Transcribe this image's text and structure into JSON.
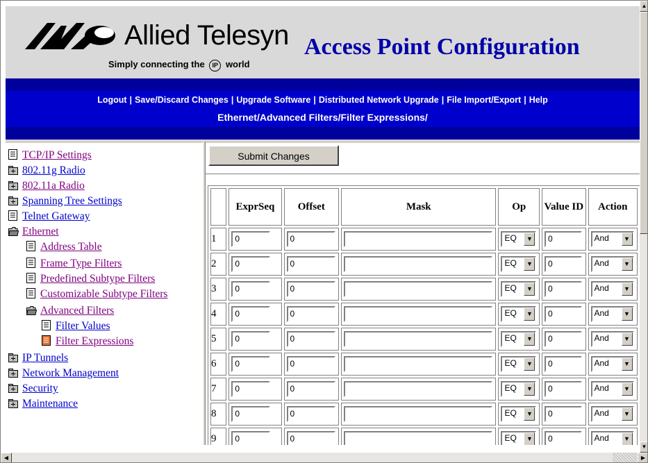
{
  "brand": {
    "company": "Allied Telesyn",
    "tagline_pre": "Simply connecting the",
    "tagline_ip": "IP",
    "tagline_post": "world",
    "logo_color": "#000000"
  },
  "app_title": "Access Point Configuration",
  "nav_links": [
    "Logout",
    "Save/Discard Changes",
    "Upgrade Software",
    "Distributed Network Upgrade",
    "File Import/Export",
    "Help"
  ],
  "breadcrumb": "Ethernet/Advanced Filters/Filter Expressions/",
  "colors": {
    "nav_blue": "#0000cc",
    "dark_blue": "#00009c",
    "title_blue": "#0000aa",
    "link": "#0000cc",
    "visited": "#800080",
    "selected_icon": "#e07030"
  },
  "sidebar": {
    "items": [
      {
        "label": "TCP/IP Settings",
        "icon": "page-icon",
        "indent": 0,
        "visited": true
      },
      {
        "label": "802.11g Radio",
        "icon": "folder-closed-icon",
        "indent": 0
      },
      {
        "label": "802.11a Radio",
        "icon": "folder-closed-icon",
        "indent": 0,
        "visited": true
      },
      {
        "label": "Spanning Tree Settings",
        "icon": "folder-closed-icon",
        "indent": 0
      },
      {
        "label": "Telnet Gateway",
        "icon": "page-icon",
        "indent": 0
      },
      {
        "label": "Ethernet",
        "icon": "folder-open-icon",
        "indent": 0,
        "visited": true
      },
      {
        "label": "Address Table",
        "icon": "page-icon",
        "indent": 1,
        "visited": true
      },
      {
        "label": "Frame Type Filters",
        "icon": "page-icon",
        "indent": 1,
        "visited": true
      },
      {
        "label": "Predefined Subtype Filters",
        "icon": "page-icon",
        "indent": 1,
        "visited": true
      },
      {
        "label": "Customizable Subtype Filters",
        "icon": "page-icon",
        "indent": 1,
        "visited": true
      },
      {
        "label": "Advanced Filters",
        "icon": "folder-open-icon",
        "indent": 1,
        "visited": true
      },
      {
        "label": "Filter Values",
        "icon": "page-icon",
        "indent": 2
      },
      {
        "label": "Filter Expressions",
        "icon": "page-selected-icon",
        "indent": 2,
        "visited": true
      },
      {
        "label": "IP Tunnels",
        "icon": "folder-closed-icon",
        "indent": 0
      },
      {
        "label": "Network Management",
        "icon": "folder-closed-icon",
        "indent": 0
      },
      {
        "label": "Security",
        "icon": "folder-closed-icon",
        "indent": 0
      },
      {
        "label": "Maintenance",
        "icon": "folder-closed-icon",
        "indent": 0
      }
    ]
  },
  "main": {
    "submit_label": "Submit Changes",
    "columns": [
      "",
      "ExprSeq",
      "Offset",
      "Mask",
      "Op",
      "Value ID",
      "Action"
    ],
    "rows": [
      {
        "num": "1",
        "exprseq": "0",
        "offset": "0",
        "mask": "",
        "op": "EQ",
        "value_id": "0",
        "action": "And"
      },
      {
        "num": "2",
        "exprseq": "0",
        "offset": "0",
        "mask": "",
        "op": "EQ",
        "value_id": "0",
        "action": "And"
      },
      {
        "num": "3",
        "exprseq": "0",
        "offset": "0",
        "mask": "",
        "op": "EQ",
        "value_id": "0",
        "action": "And"
      },
      {
        "num": "4",
        "exprseq": "0",
        "offset": "0",
        "mask": "",
        "op": "EQ",
        "value_id": "0",
        "action": "And"
      },
      {
        "num": "5",
        "exprseq": "0",
        "offset": "0",
        "mask": "",
        "op": "EQ",
        "value_id": "0",
        "action": "And"
      },
      {
        "num": "6",
        "exprseq": "0",
        "offset": "0",
        "mask": "",
        "op": "EQ",
        "value_id": "0",
        "action": "And"
      },
      {
        "num": "7",
        "exprseq": "0",
        "offset": "0",
        "mask": "",
        "op": "EQ",
        "value_id": "0",
        "action": "And"
      },
      {
        "num": "8",
        "exprseq": "0",
        "offset": "0",
        "mask": "",
        "op": "EQ",
        "value_id": "0",
        "action": "And"
      },
      {
        "num": "9",
        "exprseq": "0",
        "offset": "0",
        "mask": "",
        "op": "EQ",
        "value_id": "0",
        "action": "And"
      }
    ]
  }
}
